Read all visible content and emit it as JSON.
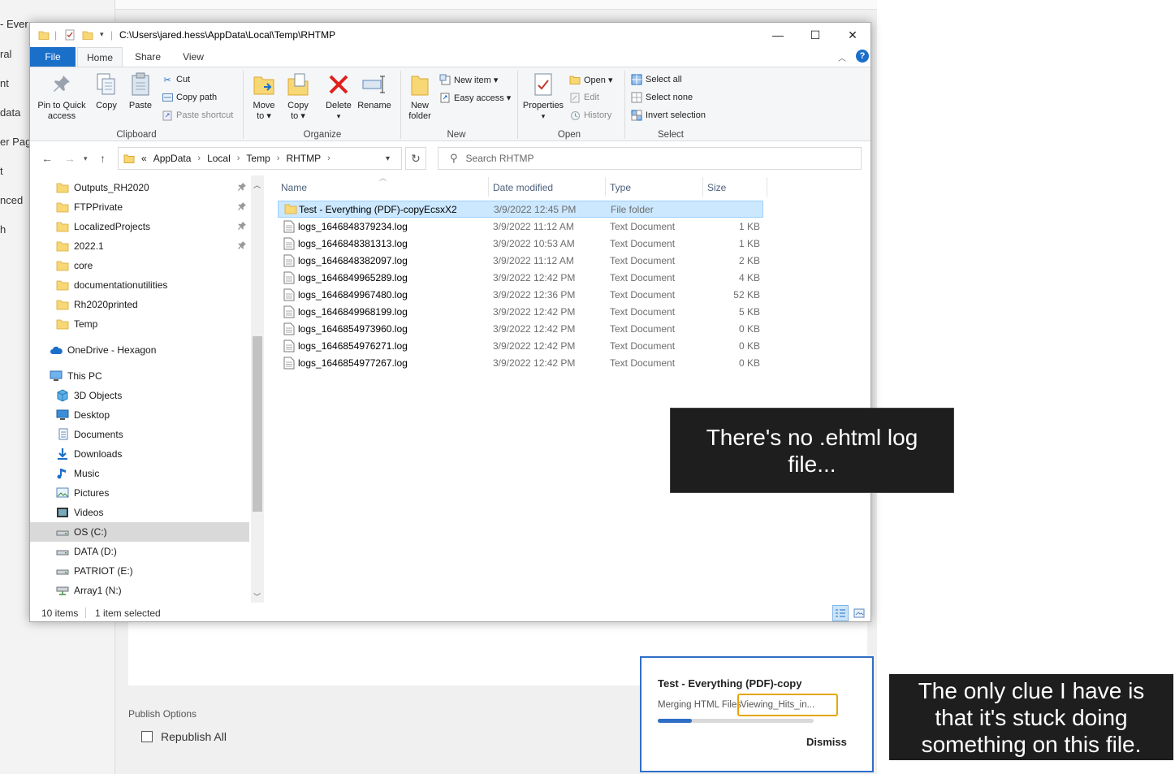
{
  "background": {
    "title_fragment": "- Ever",
    "left_nav": [
      "ral",
      "nt",
      "data",
      "er Page",
      "t",
      "nced",
      "h"
    ],
    "publish_options_label": "Publish Options",
    "republish_all_label": "Republish All"
  },
  "explorer": {
    "title_path": "C:\\Users\\jared.hess\\AppData\\Local\\Temp\\RHTMP",
    "window_buttons": {
      "minimize": "—",
      "maximize": "☐",
      "close": "✕"
    },
    "tabs": {
      "file": "File",
      "home": "Home",
      "share": "Share",
      "view": "View"
    },
    "help": "?",
    "ribbon": {
      "clipboard": {
        "label": "Clipboard",
        "pin_label_1": "Pin to Quick",
        "pin_label_2": "access",
        "copy": "Copy",
        "paste": "Paste",
        "cut": "Cut",
        "copy_path": "Copy path",
        "paste_shortcut": "Paste shortcut"
      },
      "organize": {
        "label": "Organize",
        "move_to_1": "Move",
        "move_to_2": "to ▾",
        "copy_to_1": "Copy",
        "copy_to_2": "to ▾",
        "delete": "Delete",
        "delete_arrow": "▾",
        "rename": "Rename"
      },
      "new": {
        "label": "New",
        "new_folder_1": "New",
        "new_folder_2": "folder",
        "new_item": "New item ▾",
        "easy_access": "Easy access ▾"
      },
      "open": {
        "label": "Open",
        "properties": "Properties",
        "properties_arrow": "▾",
        "open": "Open ▾",
        "edit": "Edit",
        "history": "History"
      },
      "select": {
        "label": "Select",
        "select_all": "Select all",
        "select_none": "Select none",
        "invert_selection": "Invert selection"
      }
    },
    "address": {
      "prefix": "«",
      "crumbs": [
        "AppData",
        "Local",
        "Temp",
        "RHTMP"
      ],
      "sep": "›",
      "search_placeholder": "Search RHTMP"
    },
    "nav": [
      {
        "label": "Outputs_RH2020",
        "icon": "folder-icon",
        "pinned": true
      },
      {
        "label": "FTPPrivate",
        "icon": "folder-icon",
        "pinned": true
      },
      {
        "label": "LocalizedProjects",
        "icon": "folder-icon",
        "pinned": true
      },
      {
        "label": "2022.1",
        "icon": "folder-icon",
        "pinned": true
      },
      {
        "label": "core",
        "icon": "folder-icon",
        "pinned": false
      },
      {
        "label": "documentationutilities",
        "icon": "folder-icon",
        "pinned": false
      },
      {
        "label": "Rh2020printed",
        "icon": "folder-icon",
        "pinned": false
      },
      {
        "label": "Temp",
        "icon": "folder-icon",
        "pinned": false
      },
      {
        "label": "OneDrive - Hexagon",
        "icon": "cloud-icon",
        "pinned": false
      },
      {
        "label": "This PC",
        "icon": "computer-icon",
        "pinned": false
      },
      {
        "label": "3D Objects",
        "icon": "cube-icon",
        "pinned": false
      },
      {
        "label": "Desktop",
        "icon": "desktop-icon",
        "pinned": false
      },
      {
        "label": "Documents",
        "icon": "documents-icon",
        "pinned": false
      },
      {
        "label": "Downloads",
        "icon": "download-icon",
        "pinned": false
      },
      {
        "label": "Music",
        "icon": "music-icon",
        "pinned": false
      },
      {
        "label": "Pictures",
        "icon": "pictures-icon",
        "pinned": false
      },
      {
        "label": "Videos",
        "icon": "videos-icon",
        "pinned": false
      },
      {
        "label": "OS (C:)",
        "icon": "drive-icon",
        "pinned": false,
        "selected": true
      },
      {
        "label": "DATA (D:)",
        "icon": "drive-icon",
        "pinned": false
      },
      {
        "label": "PATRIOT (E:)",
        "icon": "drive-icon",
        "pinned": false
      },
      {
        "label": "Array1 (N:)",
        "icon": "network-drive-icon",
        "pinned": false
      }
    ],
    "columns": {
      "name": "Name",
      "date": "Date modified",
      "type": "Type",
      "size": "Size"
    },
    "files": [
      {
        "name": "Test - Everything (PDF)-copyEcsxX2",
        "date": "3/9/2022 12:45 PM",
        "type": "File folder",
        "size": "",
        "folder": true,
        "selected": true
      },
      {
        "name": "logs_1646848379234.log",
        "date": "3/9/2022 11:12 AM",
        "type": "Text Document",
        "size": "1 KB"
      },
      {
        "name": "logs_1646848381313.log",
        "date": "3/9/2022 10:53 AM",
        "type": "Text Document",
        "size": "1 KB"
      },
      {
        "name": "logs_1646848382097.log",
        "date": "3/9/2022 11:12 AM",
        "type": "Text Document",
        "size": "2 KB"
      },
      {
        "name": "logs_1646849965289.log",
        "date": "3/9/2022 12:42 PM",
        "type": "Text Document",
        "size": "4 KB"
      },
      {
        "name": "logs_1646849967480.log",
        "date": "3/9/2022 12:36 PM",
        "type": "Text Document",
        "size": "52 KB"
      },
      {
        "name": "logs_1646849968199.log",
        "date": "3/9/2022 12:42 PM",
        "type": "Text Document",
        "size": "5 KB"
      },
      {
        "name": "logs_1646854973960.log",
        "date": "3/9/2022 12:42 PM",
        "type": "Text Document",
        "size": "0 KB"
      },
      {
        "name": "logs_1646854976271.log",
        "date": "3/9/2022 12:42 PM",
        "type": "Text Document",
        "size": "0 KB"
      },
      {
        "name": "logs_1646854977267.log",
        "date": "3/9/2022 12:42 PM",
        "type": "Text Document",
        "size": "0 KB"
      }
    ],
    "status": {
      "count": "10 items",
      "selected": "1 item selected"
    }
  },
  "callouts": {
    "first": "There's no .ehtml log file...",
    "second": "The only clue I have is that it's stuck doing something on this file."
  },
  "toast": {
    "title": "Test - Everything (PDF)-copy",
    "status": "Merging HTML Files",
    "current_file": "Viewing_Hits_in...",
    "progress": 0.22,
    "dismiss": "Dismiss"
  },
  "colors": {
    "accent": "#1a6fc9",
    "folder": "#f8d775",
    "selection": "#cce8ff",
    "highlight_border": "#e6a500",
    "callout_bg": "#1e1e1e"
  }
}
